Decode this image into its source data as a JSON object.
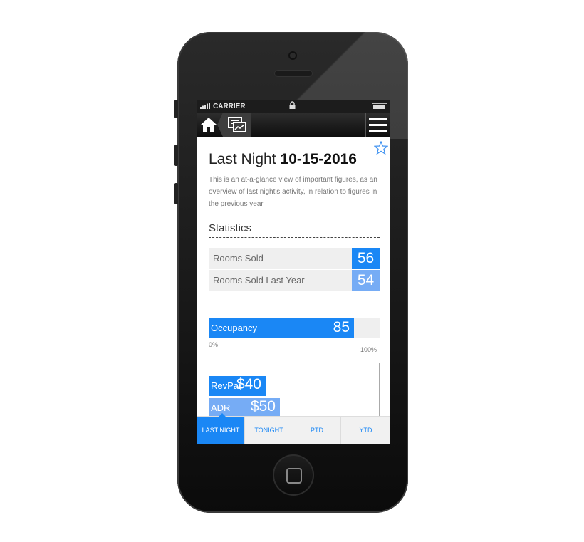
{
  "status_bar": {
    "carrier": "CARRIER",
    "signal_icon": "signal-bars-icon",
    "lock_icon": "lock-icon",
    "battery_icon": "battery-icon"
  },
  "nav": {
    "home_icon": "home-icon",
    "reports_icon": "reports-icon",
    "menu_icon": "hamburger-menu-icon"
  },
  "header": {
    "title": "Last Night",
    "date": "10-15-2016",
    "favorite_icon": "star-outline-icon",
    "description": "This is an at-a-glance view of important figures, as an overview of last night's activity, in relation to figures in the previous year."
  },
  "statistics": {
    "heading": "Statistics",
    "rows": [
      {
        "label": "Rooms Sold",
        "value": "56",
        "color": "#1a87f5"
      },
      {
        "label": "Rooms Sold Last Year",
        "value": "54",
        "color": "#76acf5"
      }
    ]
  },
  "occupancy": {
    "label": "Occupancy",
    "value": "85",
    "fraction": 0.85,
    "min_label": "0%",
    "max_label": "100%",
    "color": "#1a87f5"
  },
  "rates": {
    "bars": [
      {
        "label": "RevPar",
        "value": "$40",
        "amount": 40,
        "color": "#1a87f5"
      },
      {
        "label": "ADR",
        "value": "$50",
        "amount": 50,
        "color": "#76acf5"
      }
    ],
    "scale_max": 120
  },
  "tabs": [
    {
      "label": "LAST NIGHT",
      "active": true
    },
    {
      "label": "TONIGHT",
      "active": false
    },
    {
      "label": "PTD",
      "active": false
    },
    {
      "label": "YTD",
      "active": false
    }
  ],
  "colors": {
    "accent": "#1a87f5",
    "accent_light": "#76acf5",
    "row_bg": "#efefef"
  }
}
